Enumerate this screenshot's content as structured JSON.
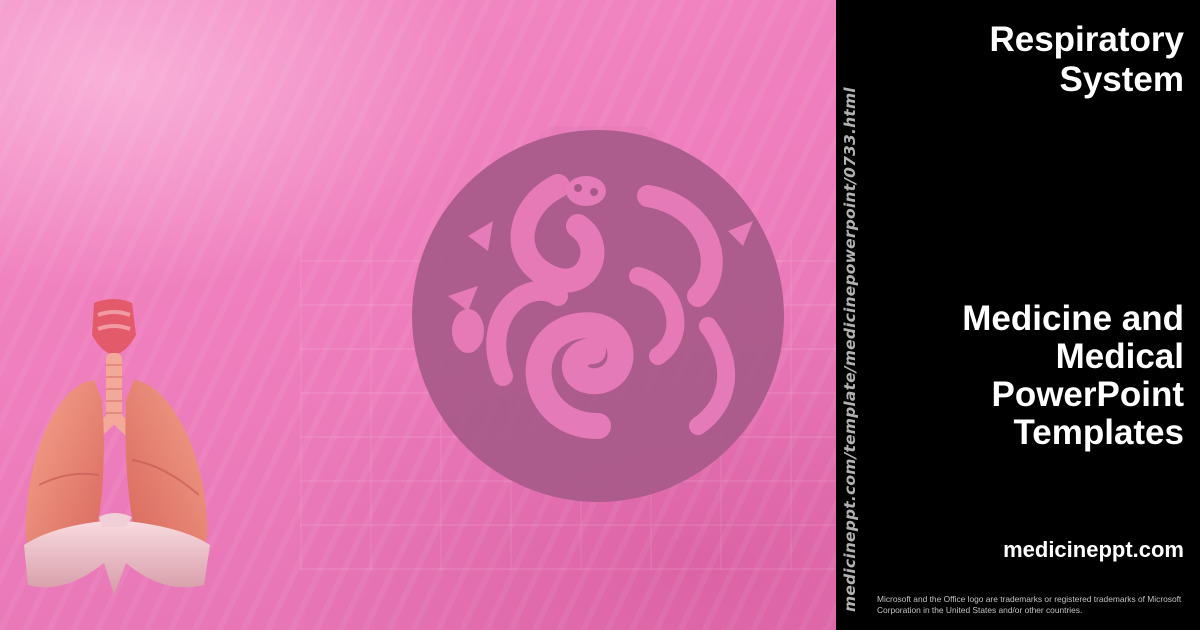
{
  "preview": {
    "title": "Respiratory\nSystem",
    "subtitle": "Medicine and\nMedical\nPowerPoint\nTemplates",
    "site": "medicineppt.com",
    "url_vertical": "medicineppt.com/template/medicinepowerpoint/0733.html",
    "legal": "Microsoft and the Office logo are trademarks or registered trademarks of Microsoft Corporation in the United States and/or other countries.",
    "icons": [
      "swirl-emblem-icon",
      "lungs-icon"
    ]
  },
  "colors": {
    "background_pink": "#ef7fbe",
    "panel": "#000000",
    "emblem": "#a75a89",
    "text": "#ffffff"
  }
}
